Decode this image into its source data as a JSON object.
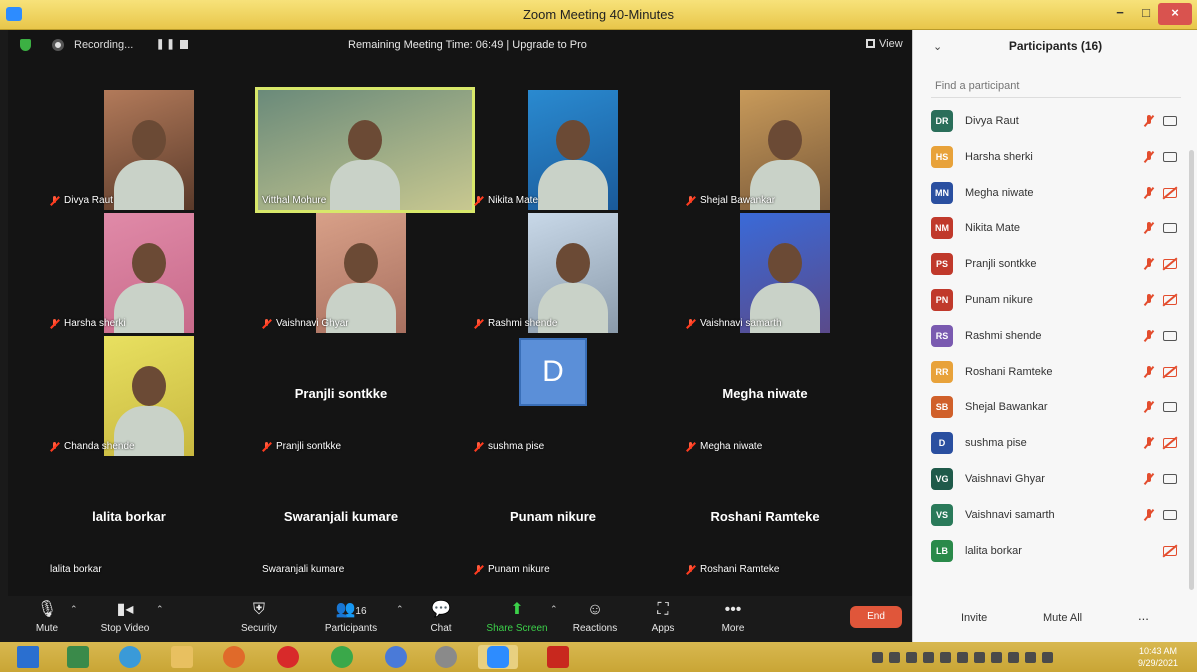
{
  "window": {
    "title": "Zoom Meeting 40-Minutes",
    "min": "−",
    "max": "□",
    "close": "×"
  },
  "topbar": {
    "recording": "Recording...",
    "pause": "❚❚",
    "remaining": "Remaining Meeting Time: 06:49 | Upgrade to Pro",
    "view": "View"
  },
  "tiles": [
    {
      "name": "Divya Raut",
      "video": true,
      "muted": true
    },
    {
      "name": "Vitthal Mohure",
      "video": true,
      "muted": false,
      "speaker": true
    },
    {
      "name": "Nikita Mate",
      "video": true,
      "muted": true
    },
    {
      "name": "Shejal Bawankar",
      "video": true,
      "muted": true
    },
    {
      "name": "Harsha sherki",
      "video": true,
      "muted": true
    },
    {
      "name": "Vaishnavi Ghyar",
      "video": true,
      "muted": true
    },
    {
      "name": "Rashmi shende",
      "video": true,
      "muted": true
    },
    {
      "name": "Vaishnavi samarth",
      "video": true,
      "muted": true
    },
    {
      "name": "Chanda shende",
      "video": true,
      "muted": true
    },
    {
      "name": "Pranjli sontkke",
      "video": false,
      "muted": true,
      "big_name": "Pranjli sontkke"
    },
    {
      "name": "sushma pise",
      "video": false,
      "muted": true,
      "avatar": "D"
    },
    {
      "name": "Megha niwate",
      "video": false,
      "muted": true,
      "big_name": "Megha niwate"
    },
    {
      "name": "lalita borkar",
      "video": false,
      "muted": false,
      "big_name": "lalita borkar"
    },
    {
      "name": "Swaranjali kumare",
      "video": false,
      "muted": false,
      "big_name": "Swaranjali kumare"
    },
    {
      "name": "Punam nikure",
      "video": false,
      "muted": true,
      "big_name": "Punam nikure"
    },
    {
      "name": "Roshani Ramteke",
      "video": false,
      "muted": true,
      "big_name": "Roshani Ramteke"
    }
  ],
  "toolbar": {
    "mute": "Mute",
    "stop_video": "Stop Video",
    "security": "Security",
    "participants": "Participants",
    "participants_count": "16",
    "chat": "Chat",
    "share_screen": "Share Screen",
    "reactions": "Reactions",
    "apps": "Apps",
    "more": "More",
    "end": "End"
  },
  "panel": {
    "title": "Participants (16)",
    "search_placeholder": "Find a participant",
    "invite": "Invite",
    "mute_all": "Mute All",
    "more": "..."
  },
  "participants": [
    {
      "initials": "DR",
      "name": "Divya Raut",
      "color": "#2a6e5a",
      "cam_off": false,
      "mic_muted": true
    },
    {
      "initials": "HS",
      "name": "Harsha sherki",
      "color": "#e8a23a",
      "cam_off": false,
      "mic_muted": true
    },
    {
      "initials": "MN",
      "name": "Megha niwate",
      "color": "#2a4fa0",
      "cam_off": true,
      "mic_muted": true
    },
    {
      "initials": "NM",
      "name": "Nikita Mate",
      "color": "#c0392b",
      "cam_off": false,
      "mic_muted": true
    },
    {
      "initials": "PS",
      "name": "Pranjli sontkke",
      "color": "#c0392b",
      "cam_off": true,
      "mic_muted": true
    },
    {
      "initials": "PN",
      "name": "Punam nikure",
      "color": "#c0392b",
      "cam_off": true,
      "mic_muted": true
    },
    {
      "initials": "RS",
      "name": "Rashmi shende",
      "color": "#7a5ab0",
      "cam_off": false,
      "mic_muted": true
    },
    {
      "initials": "RR",
      "name": "Roshani Ramteke",
      "color": "#e8a23a",
      "cam_off": true,
      "mic_muted": true
    },
    {
      "initials": "SB",
      "name": "Shejal Bawankar",
      "color": "#d0602a",
      "cam_off": false,
      "mic_muted": true
    },
    {
      "initials": "D",
      "name": "sushma pise",
      "color": "#2a4fa0",
      "cam_off": true,
      "mic_muted": true
    },
    {
      "initials": "VG",
      "name": "Vaishnavi Ghyar",
      "color": "#1f5a4a",
      "cam_off": false,
      "mic_muted": true
    },
    {
      "initials": "VS",
      "name": "Vaishnavi samarth",
      "color": "#2a7a5a",
      "cam_off": false,
      "mic_muted": true
    },
    {
      "initials": "LB",
      "name": "lalita borkar",
      "color": "#2a8a4a",
      "cam_off": true,
      "mic_muted": false
    }
  ],
  "taskbar": {
    "time": "10:43 AM",
    "date": "9/29/2021"
  }
}
